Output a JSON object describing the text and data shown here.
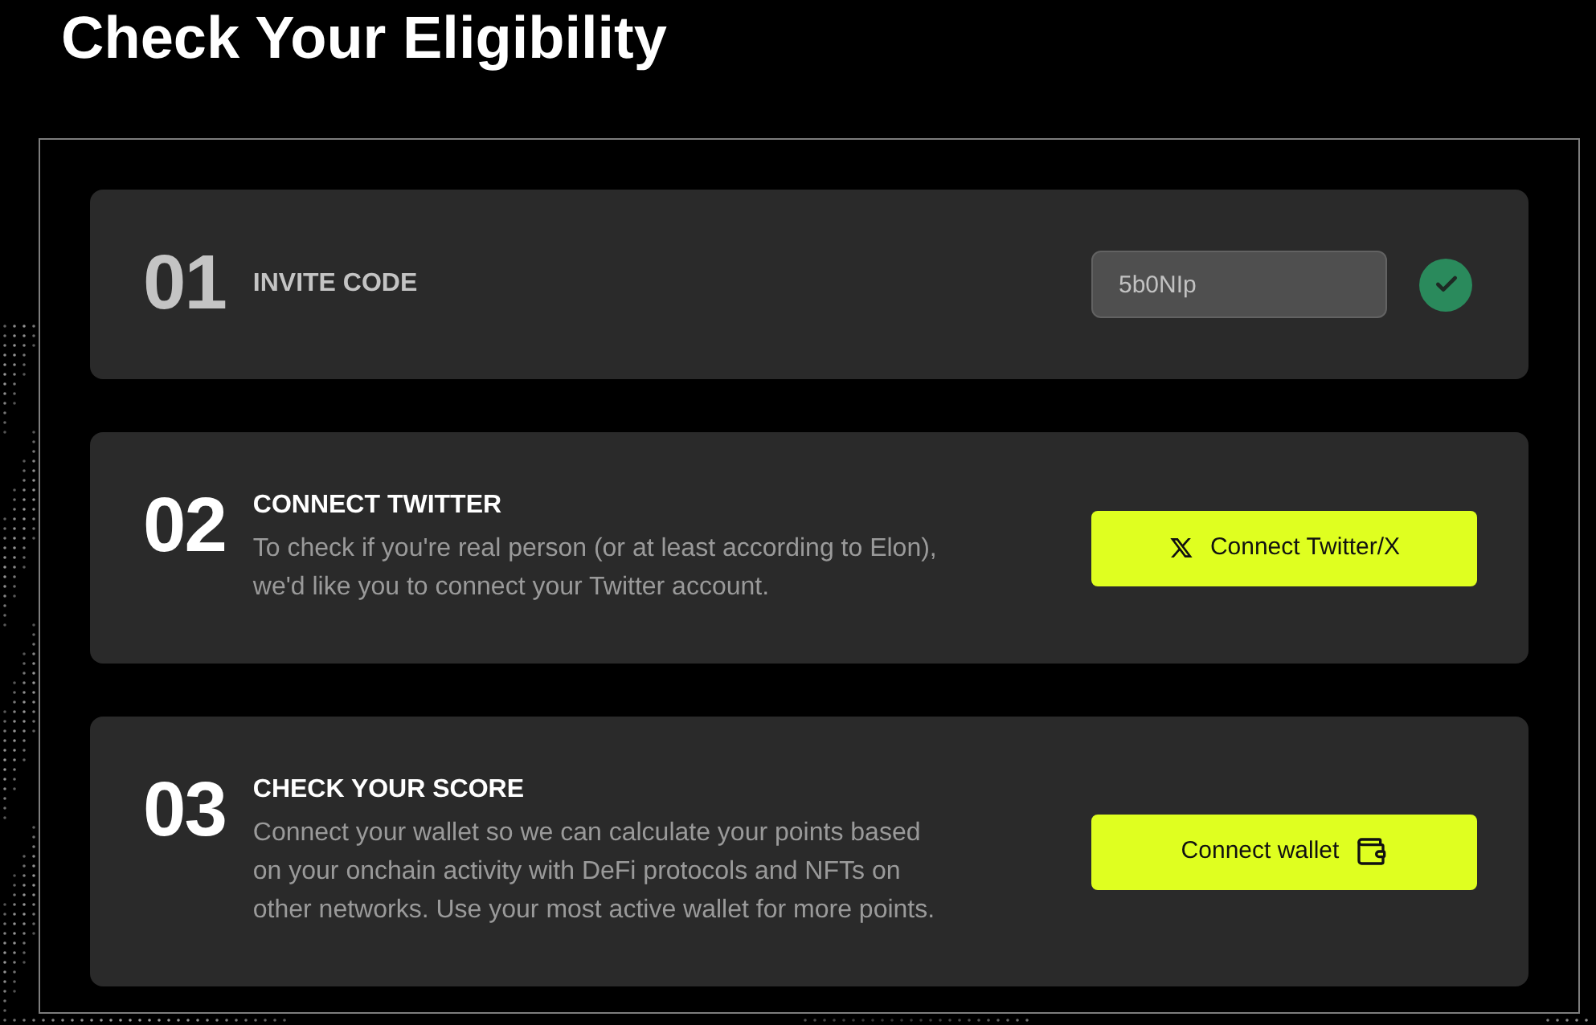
{
  "page": {
    "title": "Check Your Eligibility"
  },
  "steps": [
    {
      "kind": "code",
      "number": "01",
      "title": "INVITE CODE",
      "completed": true,
      "field": {
        "value": "5b0NIp"
      }
    },
    {
      "kind": "social",
      "number": "02",
      "title": "CONNECT TWITTER",
      "completed": false,
      "description": "To check if you're real person (or at least according to Elon), we'd like you to connect your Twitter account.",
      "button": {
        "label": "Connect Twitter/X"
      }
    },
    {
      "kind": "wallet",
      "number": "03",
      "title": "CHECK YOUR SCORE",
      "completed": false,
      "description": "Connect your wallet so we can calculate your points based on your onchain activity with DeFi protocols and NFTs on other networks. Use your most active wallet for more points.",
      "button": {
        "label": "Connect wallet"
      }
    }
  ]
}
